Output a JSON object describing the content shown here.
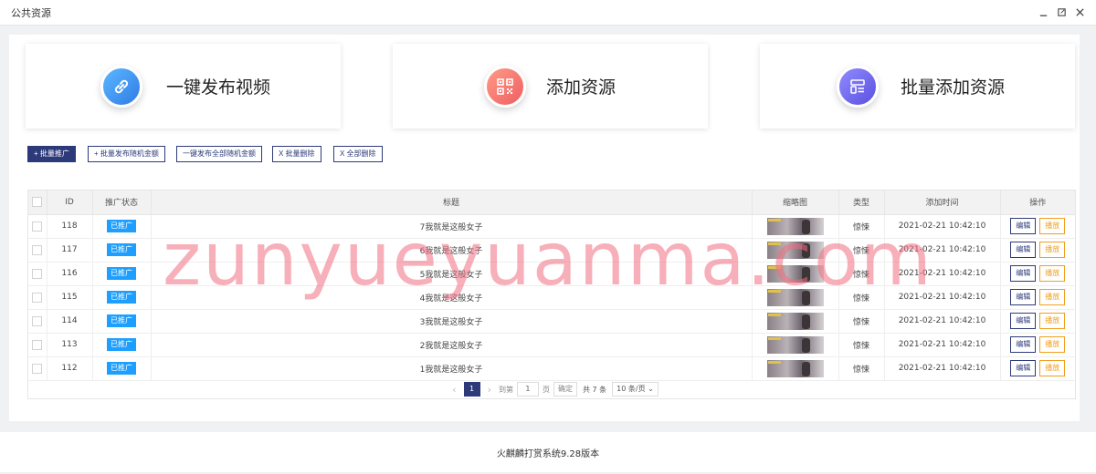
{
  "window": {
    "title": "公共资源"
  },
  "cards": [
    {
      "label": "一键发布视频",
      "icon": "link-icon",
      "color_from": "#5cb8ff",
      "color_to": "#2f7be6"
    },
    {
      "label": "添加资源",
      "icon": "qrcode-icon",
      "color_from": "#ff9b86",
      "color_to": "#ef5e62"
    },
    {
      "label": "批量添加资源",
      "icon": "list-layout-icon",
      "color_from": "#8f8cff",
      "color_to": "#5b4fe0"
    }
  ],
  "toolbar": {
    "batch_promote": "+ 批量推广",
    "batch_random_amount": "+ 批量发布随机金额",
    "publish_all_random_amount": "一键发布全部随机金额",
    "batch_delete": "X 批量删除",
    "delete_all": "X 全部删除"
  },
  "table": {
    "columns": [
      "ID",
      "推广状态",
      "标题",
      "缩略图",
      "类型",
      "添加时间",
      "操作"
    ],
    "edit_label": "编辑",
    "play_label": "播放",
    "rows": [
      {
        "id": "118",
        "status": "已推广",
        "title": "7我就是这般女子",
        "type": "惊悚",
        "time": "2021-02-21 10:42:10"
      },
      {
        "id": "117",
        "status": "已推广",
        "title": "6我就是这般女子",
        "type": "惊悚",
        "time": "2021-02-21 10:42:10"
      },
      {
        "id": "116",
        "status": "已推广",
        "title": "5我就是这般女子",
        "type": "惊悚",
        "time": "2021-02-21 10:42:10"
      },
      {
        "id": "115",
        "status": "已推广",
        "title": "4我就是这般女子",
        "type": "惊悚",
        "time": "2021-02-21 10:42:10"
      },
      {
        "id": "114",
        "status": "已推广",
        "title": "3我就是这般女子",
        "type": "惊悚",
        "time": "2021-02-21 10:42:10"
      },
      {
        "id": "113",
        "status": "已推广",
        "title": "2我就是这般女子",
        "type": "惊悚",
        "time": "2021-02-21 10:42:10"
      },
      {
        "id": "112",
        "status": "已推广",
        "title": "1我就是这般女子",
        "type": "惊悚",
        "time": "2021-02-21 10:42:10"
      }
    ]
  },
  "pager": {
    "current_page": "1",
    "goto_label": "到第",
    "goto_value": "1",
    "page_unit": "页",
    "confirm_label": "确定",
    "total_label": "共 7 条",
    "per_page_label": "10 条/页"
  },
  "footer": {
    "text": "火麒麟打赏系统9.28版本"
  },
  "watermark": {
    "text": "zunyueyuanma.com"
  }
}
